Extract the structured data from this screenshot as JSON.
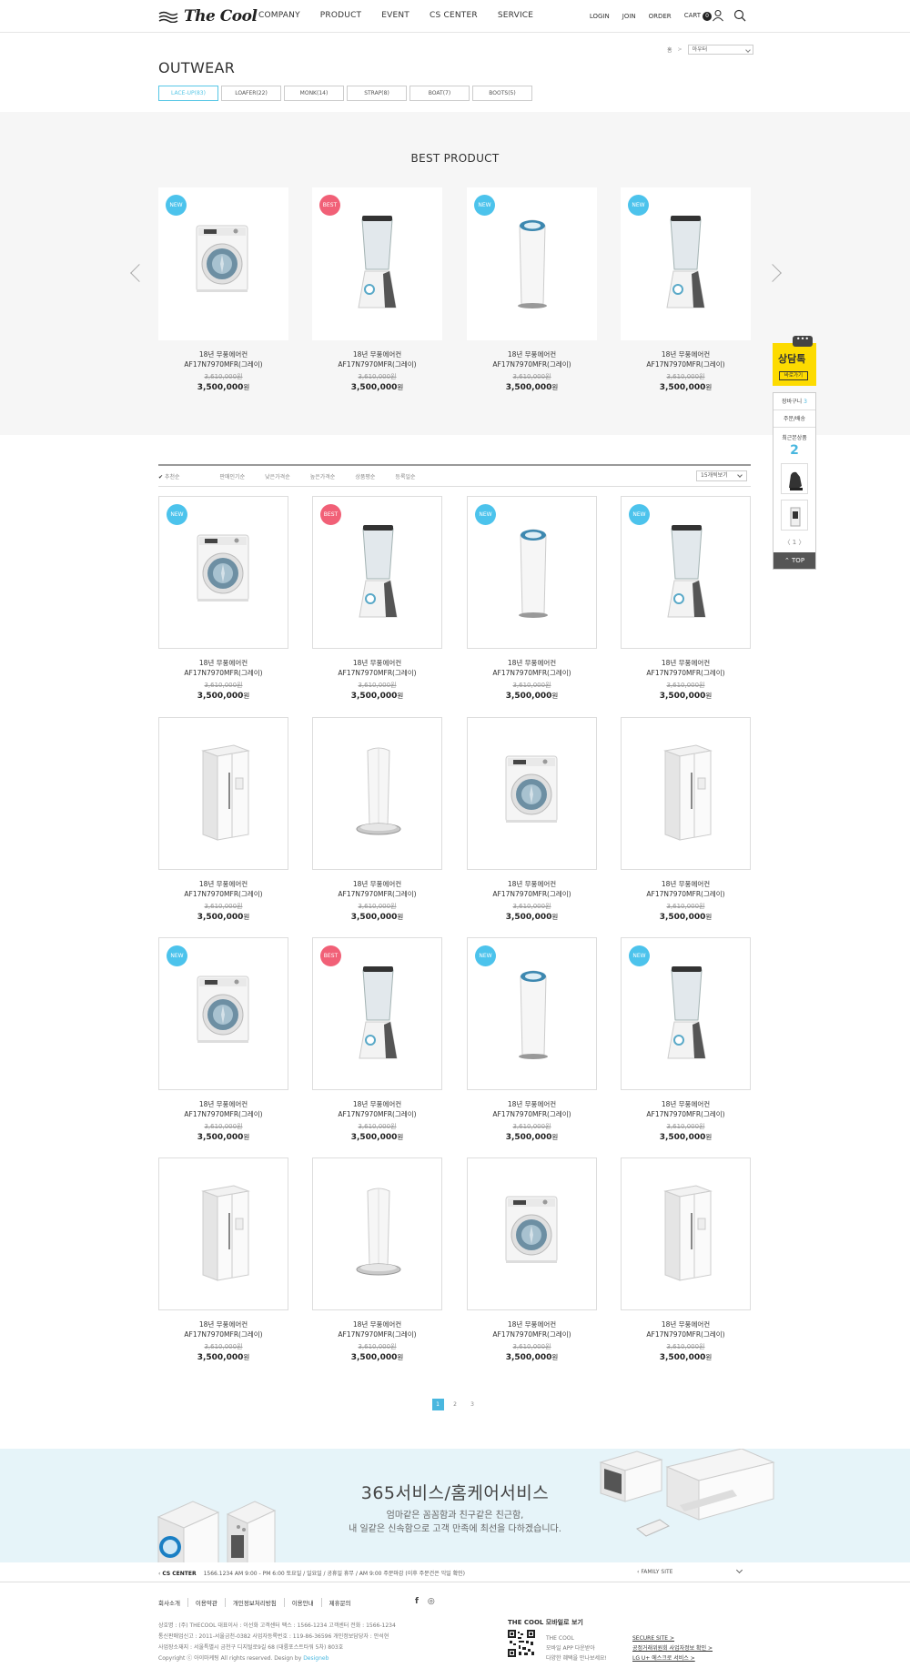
{
  "brand": "The Cool",
  "gnb": [
    "COMPANY",
    "PRODUCT",
    "EVENT",
    "CS CENTER",
    "SERVICE"
  ],
  "util": {
    "login": "LOGIN",
    "join": "JOIN",
    "order": "ORDER",
    "cart": "CART",
    "cart_count": "0"
  },
  "breadcrumb": {
    "home": "홈",
    "sep": ">",
    "select": "아우터"
  },
  "page_title": "OUTWEAR",
  "categories": [
    "LACE-UP(83)",
    "LOAFER(22)",
    "MONK(14)",
    "STRAP(8)",
    "BOAT(7)",
    "BOOTS(5)"
  ],
  "best": {
    "title": "BEST PRODUCT",
    "items": [
      {
        "badge": "NEW",
        "type": "new",
        "img": "washer",
        "name1": "18년 무풍에어컨",
        "name2": "AF17N7970MFR(그레이)",
        "old": "3,610,000원",
        "price": "3,500,000",
        "won": "원"
      },
      {
        "badge": "BEST",
        "type": "best",
        "img": "blender",
        "name1": "18년 무풍에어컨",
        "name2": "AF17N7970MFR(그레이)",
        "old": "3,610,000원",
        "price": "3,500,000",
        "won": "원"
      },
      {
        "badge": "NEW",
        "type": "new",
        "img": "purifier",
        "name1": "18년 무풍에어컨",
        "name2": "AF17N7970MFR(그레이)",
        "old": "3,610,000원",
        "price": "3,500,000",
        "won": "원"
      },
      {
        "badge": "NEW",
        "type": "new",
        "img": "blender",
        "name1": "18년 무풍에어컨",
        "name2": "AF17N7970MFR(그레이)",
        "old": "3,610,000원",
        "price": "3,500,000",
        "won": "원"
      }
    ]
  },
  "sort": {
    "items": [
      "추천순",
      "판매인기순",
      "낮은가격순",
      "높은가격순",
      "상품평순",
      "등록일순"
    ],
    "select": "15개씩보기"
  },
  "products": [
    {
      "badge": "NEW",
      "type": "new",
      "img": "washer",
      "name1": "18년 무풍에어컨",
      "name2": "AF17N7970MFR(그레이)",
      "old": "3,610,000원",
      "price": "3,500,000",
      "won": "원"
    },
    {
      "badge": "BEST",
      "type": "best",
      "img": "blender",
      "name1": "18년 무풍에어컨",
      "name2": "AF17N7970MFR(그레이)",
      "old": "3,610,000원",
      "price": "3,500,000",
      "won": "원"
    },
    {
      "badge": "NEW",
      "type": "new",
      "img": "purifier",
      "name1": "18년 무풍에어컨",
      "name2": "AF17N7970MFR(그레이)",
      "old": "3,610,000원",
      "price": "3,500,000",
      "won": "원"
    },
    {
      "badge": "NEW",
      "type": "new",
      "img": "blender",
      "name1": "18년 무풍에어컨",
      "name2": "AF17N7970MFR(그레이)",
      "old": "3,610,000원",
      "price": "3,500,000",
      "won": "원"
    },
    {
      "badge": "",
      "type": "",
      "img": "fridge",
      "name1": "18년 무풍에어컨",
      "name2": "AF17N7970MFR(그레이)",
      "old": "3,610,000원",
      "price": "3,500,000",
      "won": "원"
    },
    {
      "badge": "",
      "type": "",
      "img": "tower",
      "name1": "18년 무풍에어컨",
      "name2": "AF17N7970MFR(그레이)",
      "old": "3,610,000원",
      "price": "3,500,000",
      "won": "원"
    },
    {
      "badge": "",
      "type": "",
      "img": "washer",
      "name1": "18년 무풍에어컨",
      "name2": "AF17N7970MFR(그레이)",
      "old": "3,610,000원",
      "price": "3,500,000",
      "won": "원"
    },
    {
      "badge": "",
      "type": "",
      "img": "fridge",
      "name1": "18년 무풍에어컨",
      "name2": "AF17N7970MFR(그레이)",
      "old": "3,610,000원",
      "price": "3,500,000",
      "won": "원"
    },
    {
      "badge": "NEW",
      "type": "new",
      "img": "washer",
      "name1": "18년 무풍에어컨",
      "name2": "AF17N7970MFR(그레이)",
      "old": "3,610,000원",
      "price": "3,500,000",
      "won": "원"
    },
    {
      "badge": "BEST",
      "type": "best",
      "img": "blender",
      "name1": "18년 무풍에어컨",
      "name2": "AF17N7970MFR(그레이)",
      "old": "3,610,000원",
      "price": "3,500,000",
      "won": "원"
    },
    {
      "badge": "NEW",
      "type": "new",
      "img": "purifier",
      "name1": "18년 무풍에어컨",
      "name2": "AF17N7970MFR(그레이)",
      "old": "3,610,000원",
      "price": "3,500,000",
      "won": "원"
    },
    {
      "badge": "NEW",
      "type": "new",
      "img": "blender",
      "name1": "18년 무풍에어컨",
      "name2": "AF17N7970MFR(그레이)",
      "old": "3,610,000원",
      "price": "3,500,000",
      "won": "원"
    },
    {
      "badge": "",
      "type": "",
      "img": "fridge",
      "name1": "18년 무풍에어컨",
      "name2": "AF17N7970MFR(그레이)",
      "old": "3,610,000원",
      "price": "3,500,000",
      "won": "원"
    },
    {
      "badge": "",
      "type": "",
      "img": "tower",
      "name1": "18년 무풍에어컨",
      "name2": "AF17N7970MFR(그레이)",
      "old": "3,610,000원",
      "price": "3,500,000",
      "won": "원"
    },
    {
      "badge": "",
      "type": "",
      "img": "washer",
      "name1": "18년 무풍에어컨",
      "name2": "AF17N7970MFR(그레이)",
      "old": "3,610,000원",
      "price": "3,500,000",
      "won": "원"
    },
    {
      "badge": "",
      "type": "",
      "img": "fridge",
      "name1": "18년 무풍에어컨",
      "name2": "AF17N7970MFR(그레이)",
      "old": "3,610,000원",
      "price": "3,500,000",
      "won": "원"
    }
  ],
  "pagination": [
    "1",
    "2",
    "3"
  ],
  "banner": {
    "title": "365서비스/홈케어서비스",
    "sub1": "엄마같은 꼼꼼함과 친구같은 친근함,",
    "sub2": "내 일같은 신속함으로 고객 만족에 최선을 다하겠습니다."
  },
  "footer": {
    "cs_label": "CS CENTER",
    "cs_text": "1566.1234   AM 9:00 - PM 6:00   토요일 / 일요일 / 공휴일 휴무 / AM 9:00 주문마감 (이후 주문건은 익일 확인)",
    "family": "FAMILY SITE",
    "links": [
      "회사소개",
      "이용약관",
      "개인정보처리방침",
      "이용안내",
      "제휴문의"
    ],
    "sns": [
      "f",
      "◎"
    ],
    "info1": "상호명 : (주) THECOOL     대표이사 : 이선화     고객센터 팩스 : 1566-1234     고객센터 전화 : 1566-1234",
    "info2": "통신판매업신고 : 2011-서울금천-0382     사업자등록번호 : 119-86-36596     개인정보담당자 : 안석현",
    "info3": "사업장소재지 : 서울특별시 금천구 디지털로9길 68 (대륭포스트타워 5차) 803호",
    "info4": "Copyright ⓒ 아이마케팅 All rights reserved. Design by ",
    "info4_link": "Designeb",
    "mobile_title": "THE COOL 모바일로 보기",
    "mobile_desc1": "THE COOL",
    "mobile_desc2": "모바일 APP 다운받아",
    "mobile_desc3": "다양한 혜택을 만나보세요!",
    "m_link1": "SECURE SITE >",
    "m_link2": "공정거래위원회 사업자정보 확인 >",
    "m_link3": "LG U+ 에스크로 서비스 >"
  },
  "quick": {
    "talk": "상담톡",
    "talk_btn": "바로가기",
    "bubble": "•••",
    "cart": "장바구니",
    "cart_count": "3",
    "order": "주문/배송",
    "recent": "최근본상품",
    "recent_count": "2",
    "pager": "〈  1  〉",
    "top": "⌃ TOP"
  }
}
